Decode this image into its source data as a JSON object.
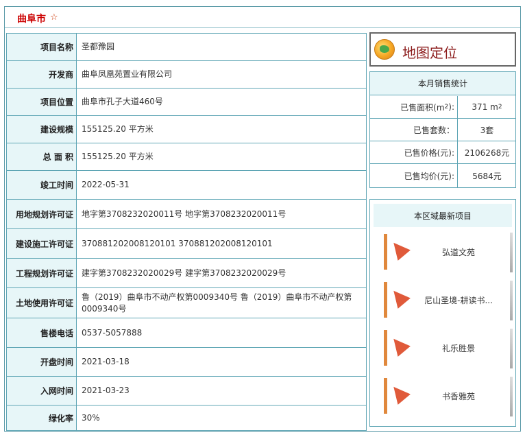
{
  "header": {
    "title": "曲阜市",
    "star": "☆"
  },
  "info_rows": [
    {
      "label": "项目名称",
      "value": "圣都豫园"
    },
    {
      "label": "开发商",
      "value": "曲阜凤凰苑置业有限公司"
    },
    {
      "label": "项目位置",
      "value": "曲阜市孔子大道460号"
    },
    {
      "label": "建设规模",
      "value": "155125.20 平方米"
    },
    {
      "label": "总 面 积",
      "value": "155125.20 平方米"
    },
    {
      "label": "竣工时间",
      "value": "2022-05-31"
    },
    {
      "label": "用地规划许可证",
      "value": "地字第3708232020011号 地字第3708232020011号"
    },
    {
      "label": "建设施工许可证",
      "value": "370881202008120101 370881202008120101"
    },
    {
      "label": "工程规划许可证",
      "value": "建字第3708232020029号 建字第3708232020029号"
    },
    {
      "label": "土地使用许可证",
      "value": "鲁（2019）曲阜市不动产权第0009340号 鲁（2019）曲阜市不动产权第0009340号"
    },
    {
      "label": "售楼电话",
      "value": "0537-5057888"
    },
    {
      "label": "开盘时间",
      "value": "2021-03-18"
    },
    {
      "label": "入网时间",
      "value": "2021-03-23"
    },
    {
      "label": "绿化率",
      "value": "30%"
    }
  ],
  "map_button": {
    "label": "地图定位",
    "icon": "globe-icon"
  },
  "sales": {
    "title": "本月销售统计",
    "area_label": "已售面积(m",
    "area_sup": "2",
    "area_label_end": "):",
    "area_value": "371 m",
    "area_value_sup": "2",
    "units_label": "已售套数：",
    "units_value": "3套",
    "price_label": "已售价格(元):",
    "price_value": "2106268元",
    "avg_label": "已售均价(元):",
    "avg_value": "5684元"
  },
  "recent": {
    "title": "本区域最新项目",
    "items": [
      "弘道文苑",
      "尼山圣境-耕读书...",
      "礼乐胜景",
      "书香雅苑"
    ]
  },
  "colors": {
    "title_red": "#cc0000",
    "border": "#5fa6b5",
    "label_bg": "#e7f6f8"
  }
}
